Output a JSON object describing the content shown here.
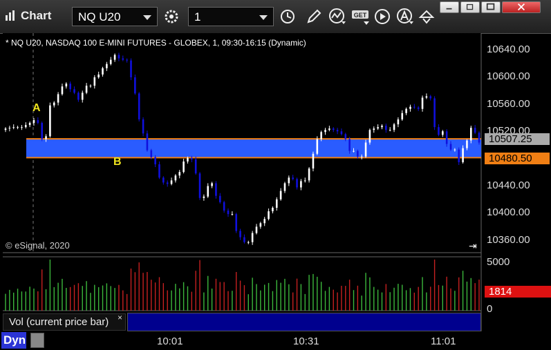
{
  "toolbar": {
    "app_title": "Chart",
    "symbol": "NQ U20",
    "interval": "1"
  },
  "chart": {
    "title": "* NQ U20, NASDAQ 100 E-MINI FUTURES - GLOBEX, 1, 09:30-16:15 (Dynamic)",
    "copyright": "© eSignal, 2020",
    "markers": {
      "a": "A",
      "b": "B"
    },
    "price_axis": [
      "10640.00",
      "10600.00",
      "10560.00",
      "10520.00",
      "10480.00",
      "10440.00",
      "10400.00",
      "10360.00"
    ],
    "tags": {
      "upper": "10507.25",
      "lower": "10480.50",
      "volume": "1814"
    },
    "volume_axis": [
      "5000",
      "0"
    ],
    "study_label": "Vol (current price bar)",
    "study_close": "×",
    "time_axis": [
      "10:01",
      "10:31",
      "11:01"
    ],
    "dyn_label": "Dyn",
    "colors": {
      "band": "#2a5cff",
      "band_edge": "#f07f14",
      "up": "#ffffff",
      "down": "#1010dd",
      "vol_up": "#3cb83c",
      "vol_down": "#c62020"
    }
  },
  "chart_data": {
    "type": "candlestick",
    "title": "* NQ U20, NASDAQ 100 E-MINI FUTURES - GLOBEX, 1, 09:30-16:15 (Dynamic)",
    "ylim": [
      10345,
      10658
    ],
    "band": [
      10480.5,
      10507.25
    ],
    "x_ticks": [
      "10:01",
      "10:31",
      "11:01"
    ],
    "closes": [
      10522,
      10523,
      10524,
      10524,
      10524,
      10527,
      10530,
      10534,
      10530,
      10507,
      10511,
      10555,
      10559,
      10571,
      10582,
      10586,
      10578,
      10573,
      10563,
      10573,
      10583,
      10583,
      10595,
      10599,
      10608,
      10614,
      10620,
      10627,
      10622,
      10620,
      10619,
      10595,
      10572,
      10535,
      10515,
      10491,
      10481,
      10471,
      10452,
      10445,
      10443,
      10448,
      10455,
      10460,
      10475,
      10480,
      10478,
      10458,
      10423,
      10425,
      10440,
      10444,
      10426,
      10417,
      10405,
      10400,
      10400,
      10376,
      10367,
      10360,
      10360,
      10373,
      10382,
      10387,
      10393,
      10404,
      10409,
      10421,
      10433,
      10444,
      10452,
      10450,
      10438,
      10447,
      10448,
      10465,
      10486,
      10507,
      10517,
      10520,
      10522,
      10520,
      10518,
      10514,
      10507,
      10490,
      10490,
      10482,
      10482,
      10502,
      10520,
      10522,
      10524,
      10526,
      10520,
      10520,
      10528,
      10535,
      10544,
      10550,
      10553,
      10552,
      10550,
      10566,
      10568,
      10565,
      10524,
      10513,
      10518,
      10500,
      10492,
      10492,
      10474,
      10494,
      10505,
      10523,
      10516,
      10502
    ],
    "volume_max": 5000,
    "volume_last": 1814
  }
}
